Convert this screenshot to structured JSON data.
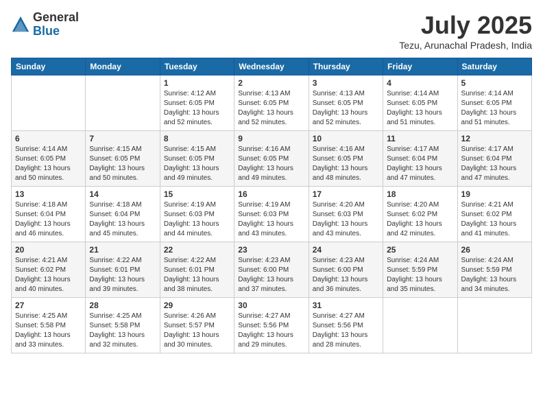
{
  "header": {
    "logo_general": "General",
    "logo_blue": "Blue",
    "month_title": "July 2025",
    "location": "Tezu, Arunachal Pradesh, India"
  },
  "weekdays": [
    "Sunday",
    "Monday",
    "Tuesday",
    "Wednesday",
    "Thursday",
    "Friday",
    "Saturday"
  ],
  "weeks": [
    [
      {
        "day": "",
        "sunrise": "",
        "sunset": "",
        "daylight": ""
      },
      {
        "day": "",
        "sunrise": "",
        "sunset": "",
        "daylight": ""
      },
      {
        "day": "1",
        "sunrise": "Sunrise: 4:12 AM",
        "sunset": "Sunset: 6:05 PM",
        "daylight": "Daylight: 13 hours and 52 minutes."
      },
      {
        "day": "2",
        "sunrise": "Sunrise: 4:13 AM",
        "sunset": "Sunset: 6:05 PM",
        "daylight": "Daylight: 13 hours and 52 minutes."
      },
      {
        "day": "3",
        "sunrise": "Sunrise: 4:13 AM",
        "sunset": "Sunset: 6:05 PM",
        "daylight": "Daylight: 13 hours and 52 minutes."
      },
      {
        "day": "4",
        "sunrise": "Sunrise: 4:14 AM",
        "sunset": "Sunset: 6:05 PM",
        "daylight": "Daylight: 13 hours and 51 minutes."
      },
      {
        "day": "5",
        "sunrise": "Sunrise: 4:14 AM",
        "sunset": "Sunset: 6:05 PM",
        "daylight": "Daylight: 13 hours and 51 minutes."
      }
    ],
    [
      {
        "day": "6",
        "sunrise": "Sunrise: 4:14 AM",
        "sunset": "Sunset: 6:05 PM",
        "daylight": "Daylight: 13 hours and 50 minutes."
      },
      {
        "day": "7",
        "sunrise": "Sunrise: 4:15 AM",
        "sunset": "Sunset: 6:05 PM",
        "daylight": "Daylight: 13 hours and 50 minutes."
      },
      {
        "day": "8",
        "sunrise": "Sunrise: 4:15 AM",
        "sunset": "Sunset: 6:05 PM",
        "daylight": "Daylight: 13 hours and 49 minutes."
      },
      {
        "day": "9",
        "sunrise": "Sunrise: 4:16 AM",
        "sunset": "Sunset: 6:05 PM",
        "daylight": "Daylight: 13 hours and 49 minutes."
      },
      {
        "day": "10",
        "sunrise": "Sunrise: 4:16 AM",
        "sunset": "Sunset: 6:05 PM",
        "daylight": "Daylight: 13 hours and 48 minutes."
      },
      {
        "day": "11",
        "sunrise": "Sunrise: 4:17 AM",
        "sunset": "Sunset: 6:04 PM",
        "daylight": "Daylight: 13 hours and 47 minutes."
      },
      {
        "day": "12",
        "sunrise": "Sunrise: 4:17 AM",
        "sunset": "Sunset: 6:04 PM",
        "daylight": "Daylight: 13 hours and 47 minutes."
      }
    ],
    [
      {
        "day": "13",
        "sunrise": "Sunrise: 4:18 AM",
        "sunset": "Sunset: 6:04 PM",
        "daylight": "Daylight: 13 hours and 46 minutes."
      },
      {
        "day": "14",
        "sunrise": "Sunrise: 4:18 AM",
        "sunset": "Sunset: 6:04 PM",
        "daylight": "Daylight: 13 hours and 45 minutes."
      },
      {
        "day": "15",
        "sunrise": "Sunrise: 4:19 AM",
        "sunset": "Sunset: 6:03 PM",
        "daylight": "Daylight: 13 hours and 44 minutes."
      },
      {
        "day": "16",
        "sunrise": "Sunrise: 4:19 AM",
        "sunset": "Sunset: 6:03 PM",
        "daylight": "Daylight: 13 hours and 43 minutes."
      },
      {
        "day": "17",
        "sunrise": "Sunrise: 4:20 AM",
        "sunset": "Sunset: 6:03 PM",
        "daylight": "Daylight: 13 hours and 43 minutes."
      },
      {
        "day": "18",
        "sunrise": "Sunrise: 4:20 AM",
        "sunset": "Sunset: 6:02 PM",
        "daylight": "Daylight: 13 hours and 42 minutes."
      },
      {
        "day": "19",
        "sunrise": "Sunrise: 4:21 AM",
        "sunset": "Sunset: 6:02 PM",
        "daylight": "Daylight: 13 hours and 41 minutes."
      }
    ],
    [
      {
        "day": "20",
        "sunrise": "Sunrise: 4:21 AM",
        "sunset": "Sunset: 6:02 PM",
        "daylight": "Daylight: 13 hours and 40 minutes."
      },
      {
        "day": "21",
        "sunrise": "Sunrise: 4:22 AM",
        "sunset": "Sunset: 6:01 PM",
        "daylight": "Daylight: 13 hours and 39 minutes."
      },
      {
        "day": "22",
        "sunrise": "Sunrise: 4:22 AM",
        "sunset": "Sunset: 6:01 PM",
        "daylight": "Daylight: 13 hours and 38 minutes."
      },
      {
        "day": "23",
        "sunrise": "Sunrise: 4:23 AM",
        "sunset": "Sunset: 6:00 PM",
        "daylight": "Daylight: 13 hours and 37 minutes."
      },
      {
        "day": "24",
        "sunrise": "Sunrise: 4:23 AM",
        "sunset": "Sunset: 6:00 PM",
        "daylight": "Daylight: 13 hours and 36 minutes."
      },
      {
        "day": "25",
        "sunrise": "Sunrise: 4:24 AM",
        "sunset": "Sunset: 5:59 PM",
        "daylight": "Daylight: 13 hours and 35 minutes."
      },
      {
        "day": "26",
        "sunrise": "Sunrise: 4:24 AM",
        "sunset": "Sunset: 5:59 PM",
        "daylight": "Daylight: 13 hours and 34 minutes."
      }
    ],
    [
      {
        "day": "27",
        "sunrise": "Sunrise: 4:25 AM",
        "sunset": "Sunset: 5:58 PM",
        "daylight": "Daylight: 13 hours and 33 minutes."
      },
      {
        "day": "28",
        "sunrise": "Sunrise: 4:25 AM",
        "sunset": "Sunset: 5:58 PM",
        "daylight": "Daylight: 13 hours and 32 minutes."
      },
      {
        "day": "29",
        "sunrise": "Sunrise: 4:26 AM",
        "sunset": "Sunset: 5:57 PM",
        "daylight": "Daylight: 13 hours and 30 minutes."
      },
      {
        "day": "30",
        "sunrise": "Sunrise: 4:27 AM",
        "sunset": "Sunset: 5:56 PM",
        "daylight": "Daylight: 13 hours and 29 minutes."
      },
      {
        "day": "31",
        "sunrise": "Sunrise: 4:27 AM",
        "sunset": "Sunset: 5:56 PM",
        "daylight": "Daylight: 13 hours and 28 minutes."
      },
      {
        "day": "",
        "sunrise": "",
        "sunset": "",
        "daylight": ""
      },
      {
        "day": "",
        "sunrise": "",
        "sunset": "",
        "daylight": ""
      }
    ]
  ]
}
